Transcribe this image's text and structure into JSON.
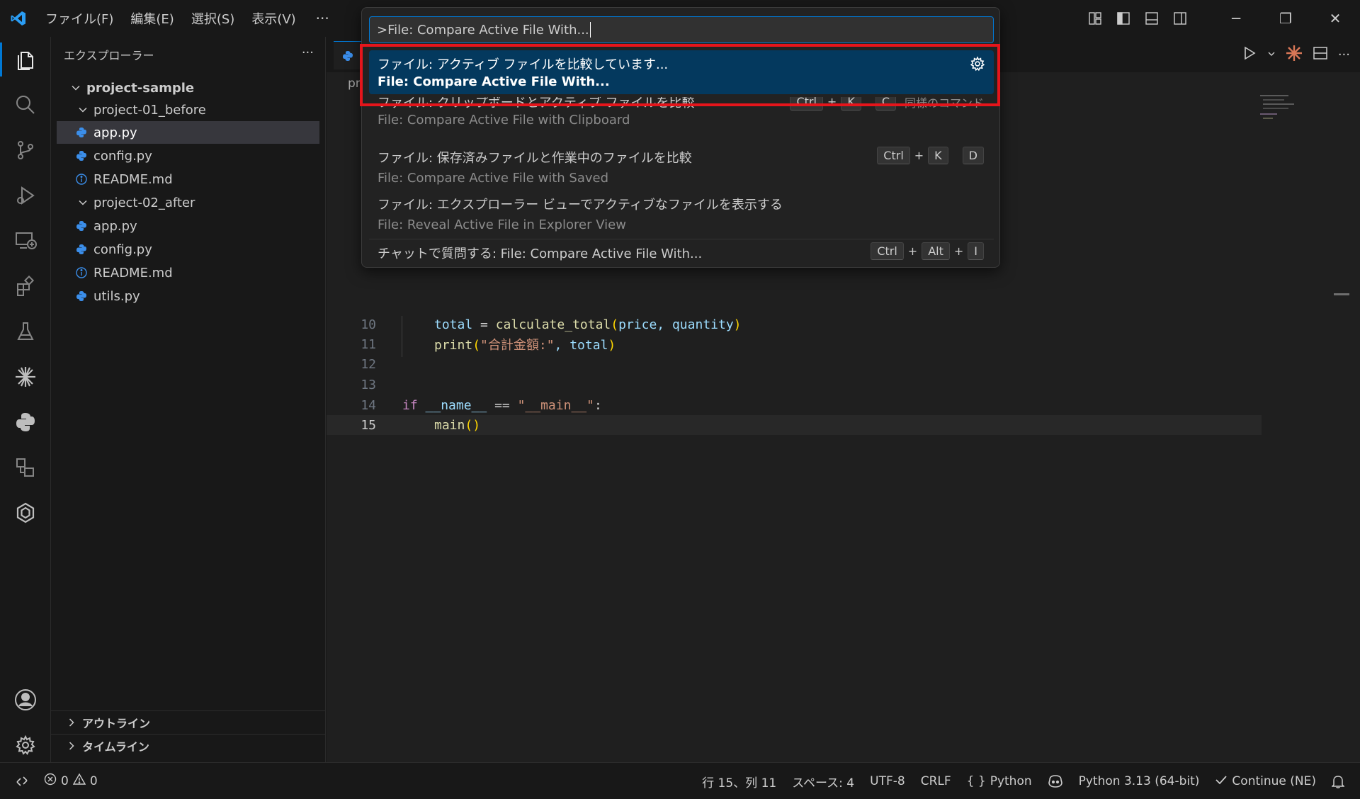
{
  "menu": {
    "items": [
      "ファイル(F)",
      "編集(E)",
      "選択(S)",
      "表示(V)"
    ],
    "more": "···"
  },
  "window_controls": {
    "minimize": "─",
    "restore": "❐",
    "close": "✕"
  },
  "sidebar": {
    "title": "エクスプローラー",
    "more": "···",
    "root": "project-sample",
    "folder1": "project-01_before",
    "folder1_files": [
      "app.py",
      "config.py",
      "README.md"
    ],
    "folder2": "project-02_after",
    "folder2_files": [
      "app.py",
      "config.py",
      "README.md",
      "utils.py"
    ],
    "outline": "アウトライン",
    "timeline": "タイムライン"
  },
  "editor": {
    "breadcrumb": "pr",
    "lines": [
      {
        "n": "10",
        "current": false
      },
      {
        "n": "11",
        "current": false
      },
      {
        "n": "12",
        "current": false
      },
      {
        "n": "13",
        "current": false
      },
      {
        "n": "14",
        "current": false
      },
      {
        "n": "15",
        "current": true
      }
    ],
    "code": {
      "l10_a": "total",
      "l10_b": " = ",
      "l10_fn": "calculate_total",
      "l10_p1": "(",
      "l10_args": "price, quantity",
      "l10_p2": ")",
      "l11_fn": "print",
      "l11_p1": "(",
      "l11_str": "\"合計金額:\"",
      "l11_rest": ", total",
      "l11_p2": ")",
      "l14_kw": "if",
      "l14_a": " __name__ ",
      "l14_op": "==",
      "l14_str": " \"__main__\"",
      "l14_colon": ":",
      "l15_fn": "main",
      "l15_p": "()"
    }
  },
  "palette": {
    "query": ">File: Compare Active File With...",
    "items": [
      {
        "jp": "ファイル: アクティブ ファイルを比較しています...",
        "en": "File: Compare Active File With..."
      },
      {
        "jp": "ファイル: クリップボードとアクティブ ファイルを比較",
        "en": "File: Compare Active File with Clipboard",
        "keys": [
          "Ctrl",
          "K",
          "C"
        ],
        "note": "同様のコマンド"
      },
      {
        "jp": "ファイル: 保存済みファイルと作業中のファイルを比較",
        "en": "File: Compare Active File with Saved",
        "keys": [
          "Ctrl",
          "K",
          "D"
        ]
      },
      {
        "jp": "ファイル: エクスプローラー ビューでアクティブなファイルを表示する",
        "en": "File: Reveal Active File in Explorer View"
      },
      {
        "jp": "チャットで質問する: File: Compare Active File With...",
        "keys": [
          "Ctrl",
          "Alt",
          "I"
        ]
      }
    ],
    "plus": "+"
  },
  "statusbar": {
    "errors": "0",
    "warnings": "0",
    "position": "行 15、列 11",
    "spaces": "スペース: 4",
    "encoding": "UTF-8",
    "eol": "CRLF",
    "language_braces": "{ }",
    "language": "Python",
    "interpreter": "Python 3.13 (64-bit)",
    "continue": "Continue (NE)"
  },
  "colors": {
    "accent": "#0078d4",
    "highlight_box": "#e5151b",
    "palette_selected": "#04395e",
    "python_icon": "#3b8eea"
  }
}
